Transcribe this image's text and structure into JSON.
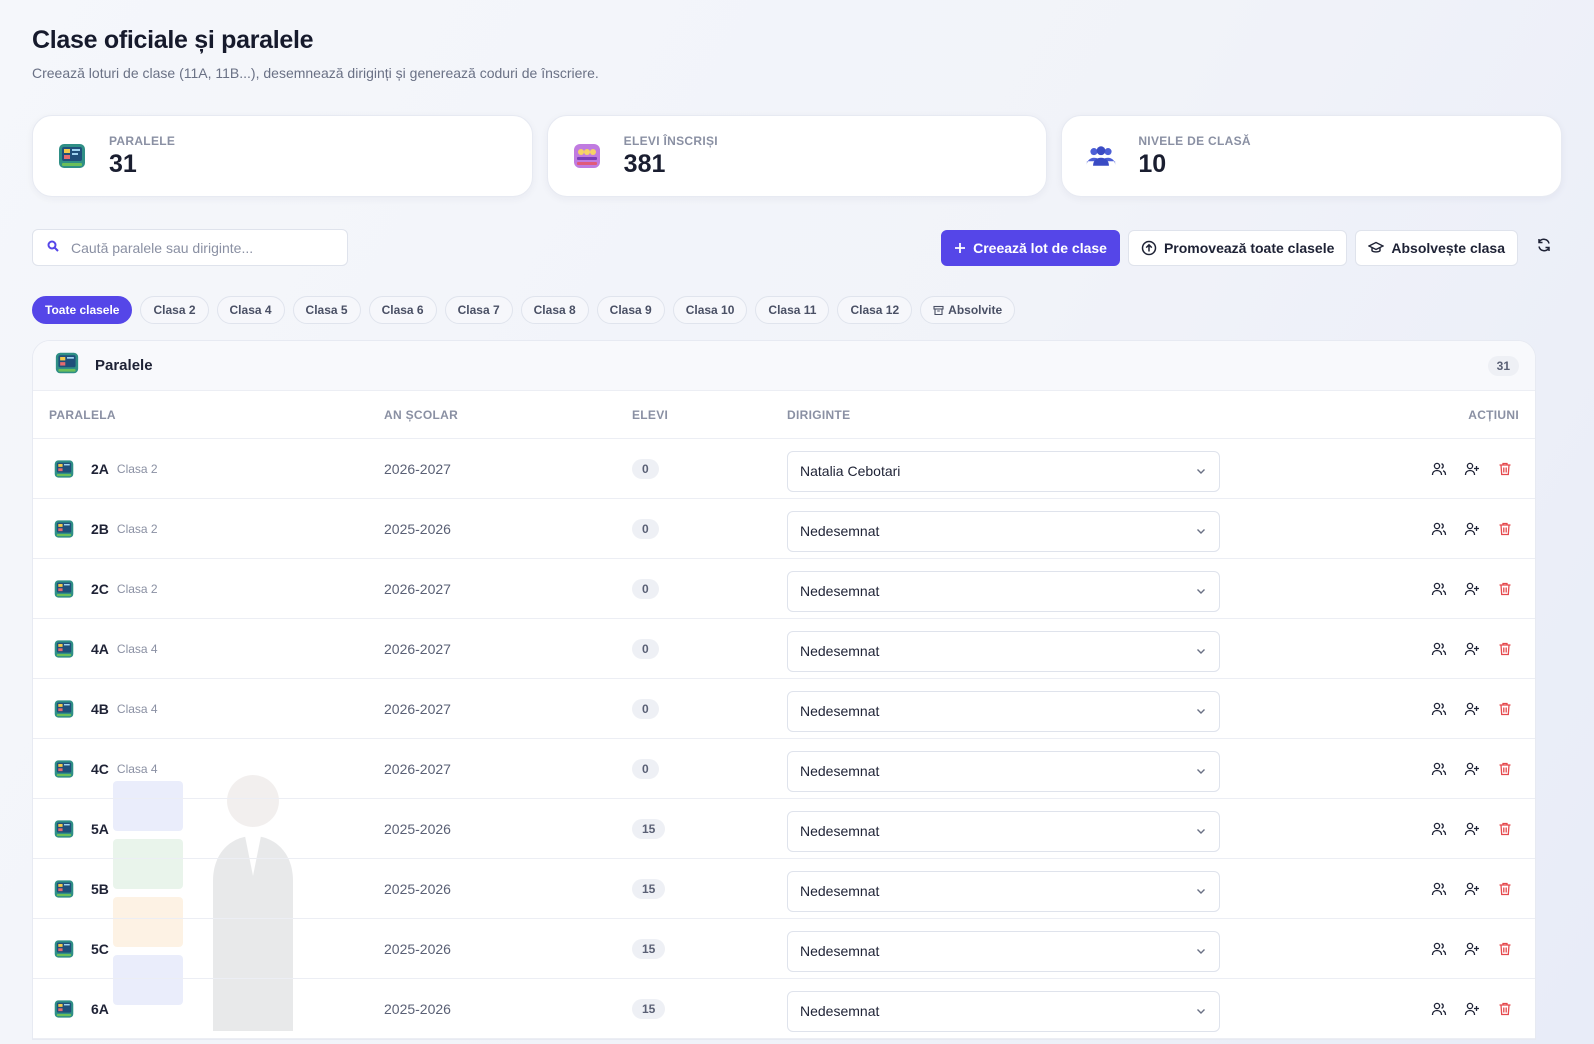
{
  "header": {
    "title": "Clase oficiale și paralele",
    "subtitle": "Creează loturi de clase (11A, 11B...), desemnează diriginți și generează coduri de înscriere."
  },
  "stats": [
    {
      "label": "PARALELE",
      "value": "31",
      "icon": "classroom-icon"
    },
    {
      "label": "ELEVI ÎNSCRIȘI",
      "value": "381",
      "icon": "students-icon"
    },
    {
      "label": "NIVELE DE CLASĂ",
      "value": "10",
      "icon": "group-icon"
    }
  ],
  "toolbar": {
    "search_placeholder": "Caută paralele sau diriginte...",
    "create_label": "Creează lot de clase",
    "promote_label": "Promovează toate clasele",
    "graduate_label": "Absolvește clasa"
  },
  "filters": [
    "Toate clasele",
    "Clasa 2",
    "Clasa 4",
    "Clasa 5",
    "Clasa 6",
    "Clasa 7",
    "Clasa 8",
    "Clasa 9",
    "Clasa 10",
    "Clasa 11",
    "Clasa 12",
    "Absolvite"
  ],
  "table": {
    "title": "Paralele",
    "count": "31",
    "columns": {
      "paralela": "PARALELA",
      "an": "AN ȘCOLAR",
      "elevi": "ELEVI",
      "diriginte": "DIRIGINTE",
      "actiuni": "ACȚIUNI"
    },
    "rows": [
      {
        "name": "2A",
        "level": "Clasa 2",
        "year": "2026-2027",
        "students": "0",
        "teacher": "Natalia Cebotari"
      },
      {
        "name": "2B",
        "level": "Clasa 2",
        "year": "2025-2026",
        "students": "0",
        "teacher": "Nedesemnat"
      },
      {
        "name": "2C",
        "level": "Clasa 2",
        "year": "2026-2027",
        "students": "0",
        "teacher": "Nedesemnat"
      },
      {
        "name": "4A",
        "level": "Clasa 4",
        "year": "2026-2027",
        "students": "0",
        "teacher": "Nedesemnat"
      },
      {
        "name": "4B",
        "level": "Clasa 4",
        "year": "2026-2027",
        "students": "0",
        "teacher": "Nedesemnat"
      },
      {
        "name": "4C",
        "level": "Clasa 4",
        "year": "2026-2027",
        "students": "0",
        "teacher": "Nedesemnat"
      },
      {
        "name": "5A",
        "level": "",
        "year": "2025-2026",
        "students": "15",
        "teacher": "Nedesemnat"
      },
      {
        "name": "5B",
        "level": "",
        "year": "2025-2026",
        "students": "15",
        "teacher": "Nedesemnat"
      },
      {
        "name": "5C",
        "level": "",
        "year": "2025-2026",
        "students": "15",
        "teacher": "Nedesemnat"
      },
      {
        "name": "6A",
        "level": "",
        "year": "2025-2026",
        "students": "15",
        "teacher": "Nedesemnat"
      }
    ]
  },
  "colors": {
    "accent": "#5546e8",
    "danger": "#e5484d"
  }
}
